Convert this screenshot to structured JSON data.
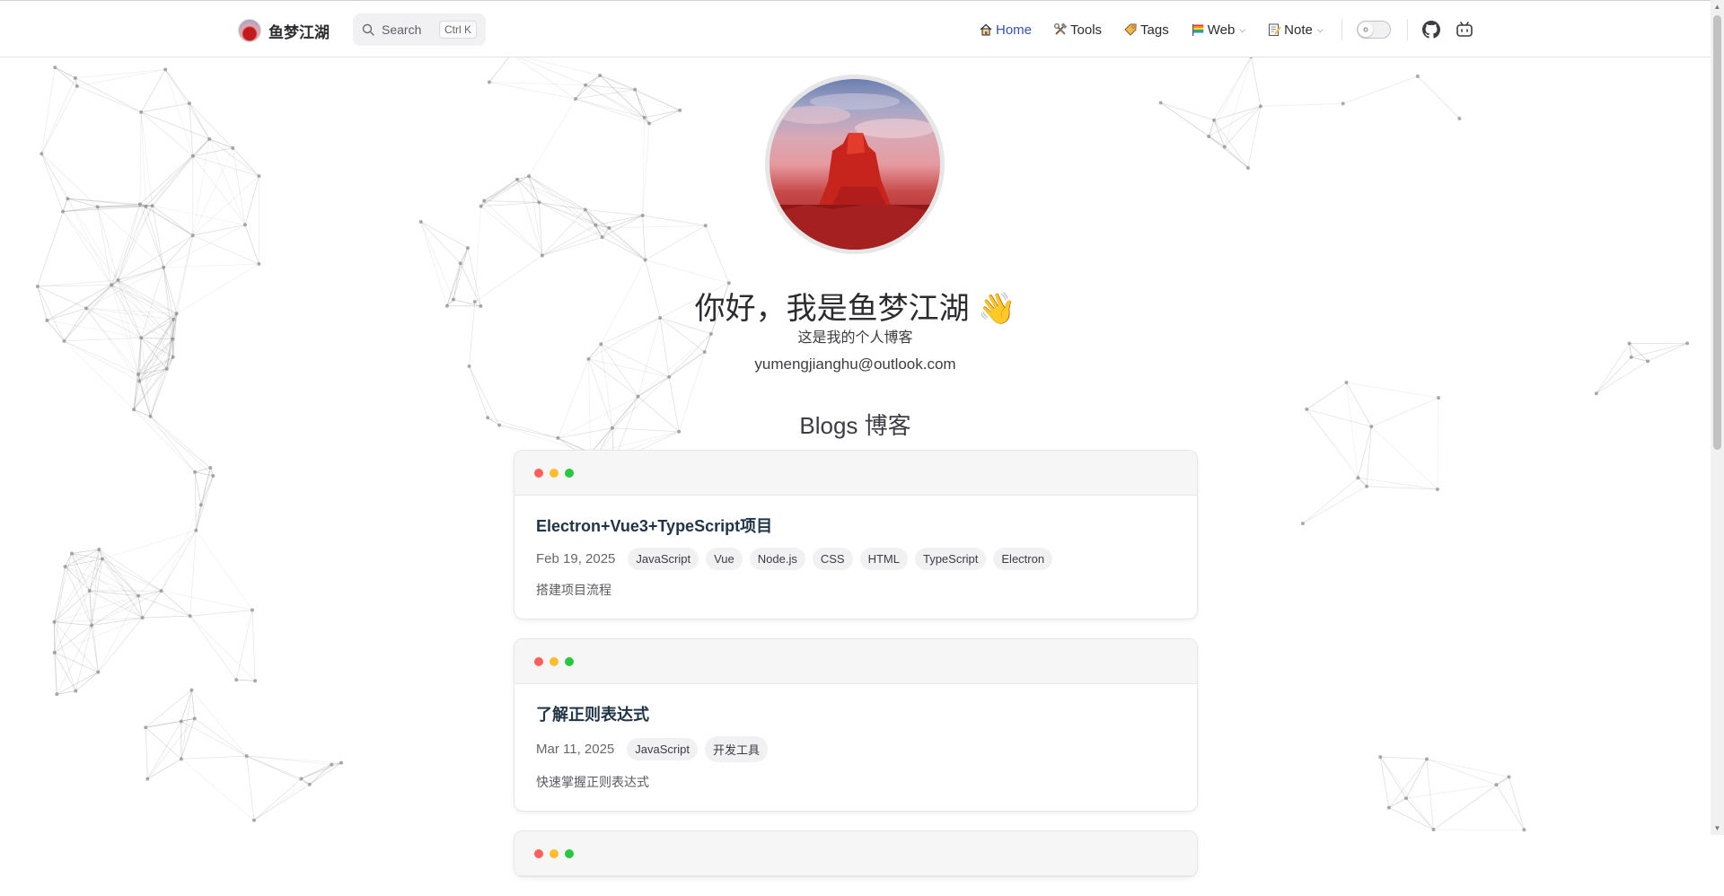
{
  "nav": {
    "brand": "鱼梦江湖",
    "search_label": "Search",
    "search_shortcut": "Ctrl K",
    "menu": [
      {
        "label": "Home",
        "icon": "house-icon",
        "active": true
      },
      {
        "label": "Tools",
        "icon": "tools-icon"
      },
      {
        "label": "Tags",
        "icon": "tag-icon"
      },
      {
        "label": "Web",
        "icon": "rainbow-flag-icon",
        "dropdown": true
      },
      {
        "label": "Note",
        "icon": "memo-icon",
        "dropdown": true
      }
    ],
    "accent_color": "#3451b2"
  },
  "hero": {
    "title": "你好，我是鱼梦江湖 👋",
    "subtitle": "这是我的个人博客",
    "email": "yumengjianghu@outlook.com"
  },
  "blogs_title": "Blogs 博客",
  "posts": [
    {
      "title": "Electron+Vue3+TypeScript项目",
      "date": "Feb 19, 2025",
      "tags": [
        "JavaScript",
        "Vue",
        "Node.js",
        "CSS",
        "HTML",
        "TypeScript",
        "Electron"
      ],
      "description": "搭建项目流程"
    },
    {
      "title": "了解正则表达式",
      "date": "Mar 11, 2025",
      "tags": [
        "JavaScript",
        "开发工具"
      ],
      "description": "快速掌握正则表达式"
    }
  ],
  "window_dots": [
    "#ff5f56",
    "#ffbd2e",
    "#27c93f"
  ]
}
